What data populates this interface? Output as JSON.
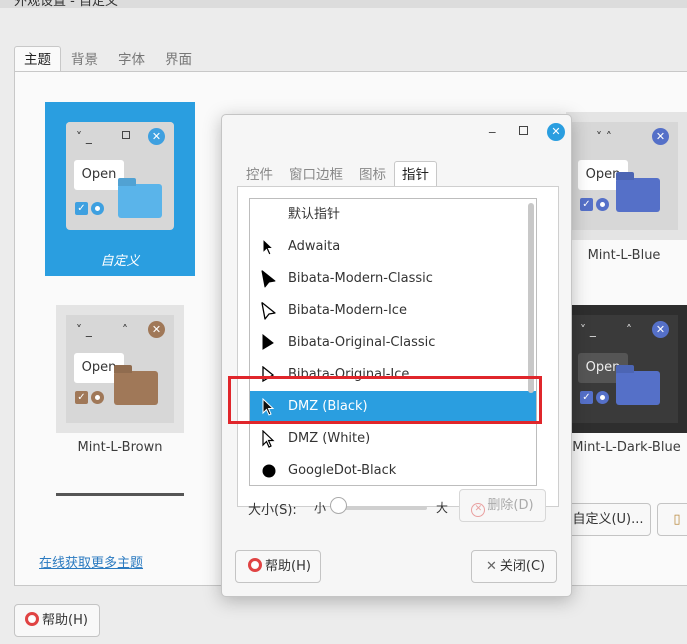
{
  "main_window": {
    "title": "外观设置 - 自定义",
    "tabs": [
      {
        "label": "主题",
        "active": true
      },
      {
        "label": "背景",
        "active": false
      },
      {
        "label": "字体",
        "active": false
      },
      {
        "label": "界面",
        "active": false
      }
    ],
    "themes": [
      {
        "name": "自定义",
        "selected": true,
        "accent": "#3ea0e0",
        "folder": "#5ab4ea",
        "dark": false
      },
      {
        "name": "Mint-L-Blue",
        "selected": false,
        "accent": "#5570c8",
        "folder": "#5570c8",
        "dark": false
      },
      {
        "name": "Mint-L-Brown",
        "selected": false,
        "accent": "#a07858",
        "folder": "#a07858",
        "dark": false
      },
      {
        "name": "Mint-L-Dark-Blue",
        "selected": false,
        "accent": "#5570c8",
        "folder": "#5570c8",
        "dark": true
      }
    ],
    "preview_open_label": "Open",
    "more_themes_link": "在线获取更多主题",
    "customize_button": "自定义(U)...",
    "help_button": "帮助(H)"
  },
  "dialog": {
    "tabs": [
      {
        "label": "控件",
        "active": false
      },
      {
        "label": "窗口边框",
        "active": false
      },
      {
        "label": "图标",
        "active": false
      },
      {
        "label": "指针",
        "active": true
      }
    ],
    "cursors": [
      {
        "label": "默认指针",
        "icon": "none",
        "selected": false
      },
      {
        "label": "Adwaita",
        "icon": "arrow-black",
        "selected": false
      },
      {
        "label": "Bibata-Modern-Classic",
        "icon": "arrow-black-round",
        "selected": false
      },
      {
        "label": "Bibata-Modern-Ice",
        "icon": "arrow-white-round",
        "selected": false
      },
      {
        "label": "Bibata-Original-Classic",
        "icon": "arrow-black",
        "selected": false
      },
      {
        "label": "Bibata-Original-Ice",
        "icon": "arrow-white",
        "selected": false
      },
      {
        "label": "DMZ (Black)",
        "icon": "arrow-black",
        "selected": true
      },
      {
        "label": "DMZ (White)",
        "icon": "arrow-white",
        "selected": false
      },
      {
        "label": "GoogleDot-Black",
        "icon": "dot-black",
        "selected": false
      }
    ],
    "size_label": "大小(S):",
    "size_small": "小",
    "size_large": "大",
    "size_value": 0,
    "delete_button": "删除(D)",
    "help_button": "帮助(H)",
    "close_button": "关闭(C)"
  },
  "colors": {
    "accent": "#2a9ee0",
    "highlight_box": "#e0262b"
  }
}
